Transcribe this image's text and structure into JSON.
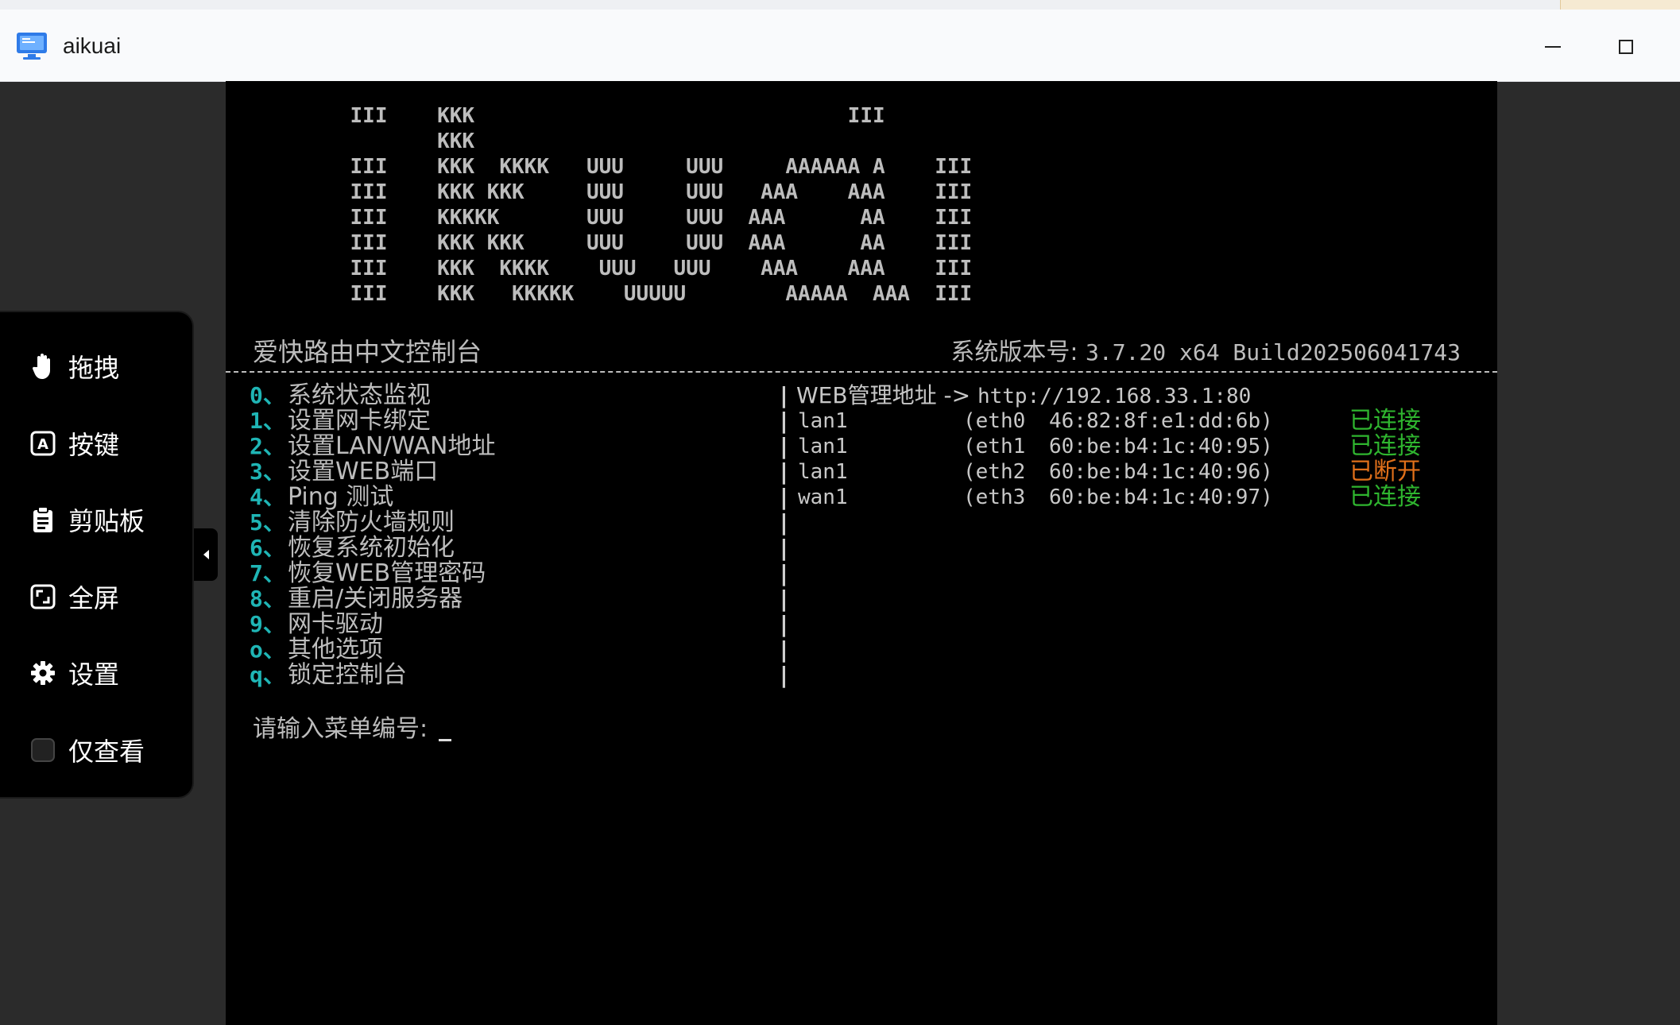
{
  "window": {
    "title": "aikuai"
  },
  "sidebar": {
    "items": [
      {
        "label": "拖拽",
        "icon": "hand-icon"
      },
      {
        "label": "按键",
        "icon": "keyboard-key-icon"
      },
      {
        "label": "剪贴板",
        "icon": "clipboard-icon"
      },
      {
        "label": "全屏",
        "icon": "fullscreen-icon"
      },
      {
        "label": "设置",
        "icon": "gear-icon"
      },
      {
        "label": "仅查看",
        "icon": "checkbox"
      }
    ]
  },
  "terminal": {
    "ascii_art": "          III    KKK                              III\n                 KKK\n          III    KKK  KKKK   UUU     UUU     AAAAAA A    III\n          III    KKK KKK     UUU     UUU   AAA    AAA    III\n          III    KKKKK       UUU     UUU  AAA      AA    III\n          III    KKK KKK     UUU     UUU  AAA      AA    III\n          III    KKK  KKKK    UUU   UUU    AAA    AAA    III\n          III    KKK   KKKKK    UUUUU        AAAAA  AAA  III",
    "header_left": "爱快路由中文控制台",
    "version_label": "系统版本号: ",
    "version_value": "3.7.20 x64 Build202506041743",
    "menu": [
      {
        "key": "0、",
        "text": "系统状态监视"
      },
      {
        "key": "1、",
        "text": "设置网卡绑定"
      },
      {
        "key": "2、",
        "text": "设置LAN/WAN地址"
      },
      {
        "key": "3、",
        "text": "设置WEB端口"
      },
      {
        "key": "4、",
        "text": "Ping 测试"
      },
      {
        "key": "5、",
        "text": "清除防火墙规则"
      },
      {
        "key": "6、",
        "text": "恢复系统初始化"
      },
      {
        "key": "7、",
        "text": "恢复WEB管理密码"
      },
      {
        "key": "8、",
        "text": "重启/关闭服务器"
      },
      {
        "key": "9、",
        "text": "网卡驱动"
      },
      {
        "key": "o、",
        "text": "其他选项"
      },
      {
        "key": "q、",
        "text": "锁定控制台"
      }
    ],
    "web_label": "WEB管理地址 -> ",
    "web_url": "http://192.168.33.1:80",
    "interfaces": [
      {
        "name": "lan1",
        "eth": "(eth0",
        "mac": "46:82:8f:e1:dd:6b)",
        "status": "已连接"
      },
      {
        "name": "lan1",
        "eth": "(eth1",
        "mac": "60:be:b4:1c:40:95)",
        "status": "已连接"
      },
      {
        "name": "lan1",
        "eth": "(eth2",
        "mac": "60:be:b4:1c:40:96)",
        "status": "已断开"
      },
      {
        "name": "wan1",
        "eth": "(eth3",
        "mac": "60:be:b4:1c:40:97)",
        "status": "已连接"
      }
    ],
    "prompt": "请输入菜单编号:"
  },
  "colors": {
    "menu_key": "#1fb5b5",
    "connected": "#2fb52f",
    "disconnected": "#e0701a"
  }
}
